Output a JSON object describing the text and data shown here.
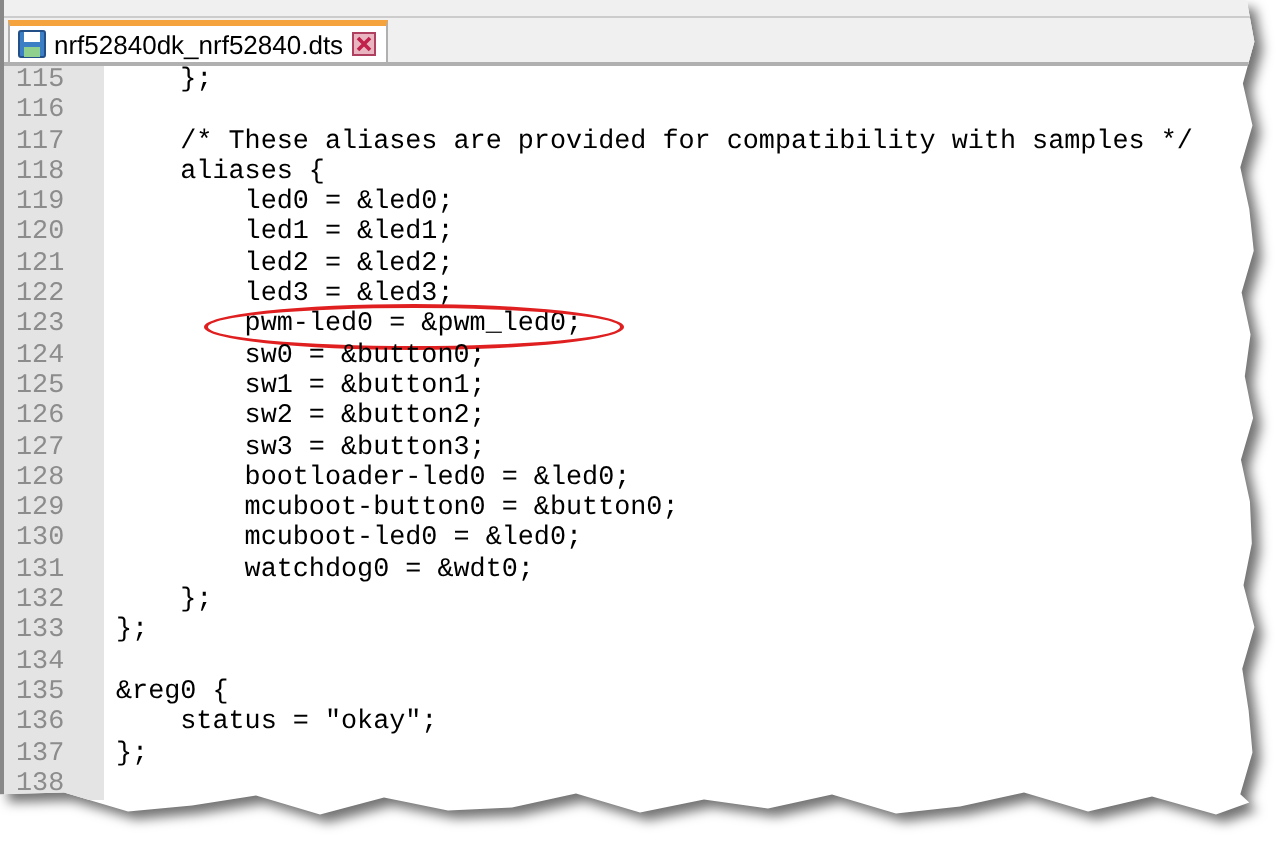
{
  "tab": {
    "label": "nrf52840dk_nrf52840.dts",
    "selected": true
  },
  "lines": [
    {
      "number": "115",
      "text": "    };",
      "circled": false
    },
    {
      "number": "116",
      "circled": false
    },
    {
      "number": "117",
      "text": "    /* These aliases are provided for compatibility with samples */",
      "circled": false
    },
    {
      "number": "118",
      "text": "    aliases {",
      "circled": false
    },
    {
      "number": "119",
      "text": "        led0 = &led0;",
      "circled": false
    },
    {
      "number": "120",
      "text": "        led1 = &led1;",
      "circled": false
    },
    {
      "number": "121",
      "text": "        led2 = &led2;",
      "circled": false
    },
    {
      "number": "122",
      "text": "        led3 = &led3;",
      "circled": false
    },
    {
      "number": "123",
      "text": "        pwm-led0 = &pwm_led0;",
      "circled": true
    },
    {
      "number": "124",
      "text": "        sw0 = &button0;",
      "circled": false
    },
    {
      "number": "125",
      "text": "        sw1 = &button1;",
      "circled": false
    },
    {
      "number": "126",
      "text": "        sw2 = &button2;",
      "circled": false
    },
    {
      "number": "127",
      "text": "        sw3 = &button3;",
      "circled": false
    },
    {
      "number": "128",
      "text": "        bootloader-led0 = &led0;",
      "circled": false
    },
    {
      "number": "129",
      "text": "        mcuboot-button0 = &button0;",
      "circled": false
    },
    {
      "number": "130",
      "text": "        mcuboot-led0 = &led0;",
      "circled": false
    },
    {
      "number": "131",
      "text": "        watchdog0 = &wdt0;",
      "circled": false
    },
    {
      "number": "132",
      "text": "    };",
      "circled": false
    },
    {
      "number": "133",
      "text": "};",
      "circled": false
    },
    {
      "number": "134",
      "circled": false
    },
    {
      "number": "135",
      "text": "&reg0 {",
      "circled": false
    },
    {
      "number": "136",
      "text": "    status = \"okay\";",
      "circled": false
    },
    {
      "number": "137",
      "text": "};",
      "circled": false
    },
    {
      "number": "138",
      "circled": false
    }
  ]
}
